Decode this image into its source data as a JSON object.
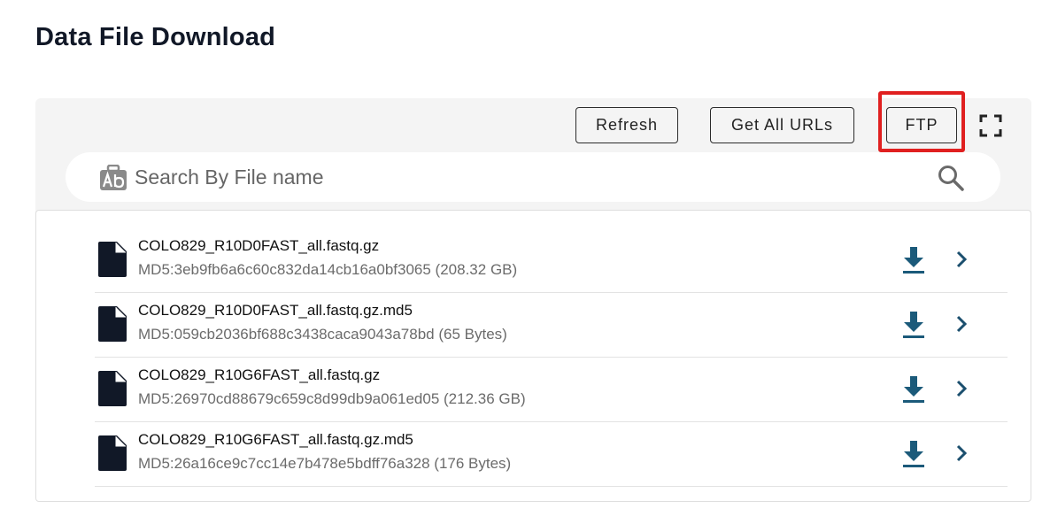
{
  "page": {
    "title": "Data File Download"
  },
  "toolbar": {
    "refresh_label": "Refresh",
    "get_all_urls_label": "Get All URLs",
    "ftp_label": "FTP",
    "fullscreen_icon": "fullscreen-icon",
    "highlight_color": "#e02020"
  },
  "search": {
    "placeholder": "Search By File name",
    "value": "",
    "leading_icon": "ab-text-icon",
    "trailing_icon": "search-icon"
  },
  "files": [
    {
      "name": "COLO829_R10D0FAST_all.fastq.gz",
      "meta": "MD5:3eb9fb6a6c60c832da14cb16a0bf3065 (208.32 GB)",
      "md5": "3eb9fb6a6c60c832da14cb16a0bf3065",
      "size": "208.32 GB"
    },
    {
      "name": "COLO829_R10D0FAST_all.fastq.gz.md5",
      "meta": "MD5:059cb2036bf688c3438caca9043a78bd (65 Bytes)",
      "md5": "059cb2036bf688c3438caca9043a78bd",
      "size": "65 Bytes"
    },
    {
      "name": "COLO829_R10G6FAST_all.fastq.gz",
      "meta": "MD5:26970cd88679c659c8d99db9a061ed05 (212.36 GB)",
      "md5": "26970cd88679c659c8d99db9a061ed05",
      "size": "212.36 GB"
    },
    {
      "name": "COLO829_R10G6FAST_all.fastq.gz.md5",
      "meta": "MD5:26a16ce9c7cc14e7b478e5bdff76a328 (176 Bytes)",
      "md5": "26a16ce9c7cc14e7b478e5bdff76a328",
      "size": "176 Bytes"
    }
  ],
  "icons": {
    "file": "file-icon",
    "download": "download-icon",
    "open": "chevron-right-icon"
  },
  "colors": {
    "accent": "#1b5a7a",
    "panel_bg": "#f4f4f4",
    "title": "#111827"
  }
}
